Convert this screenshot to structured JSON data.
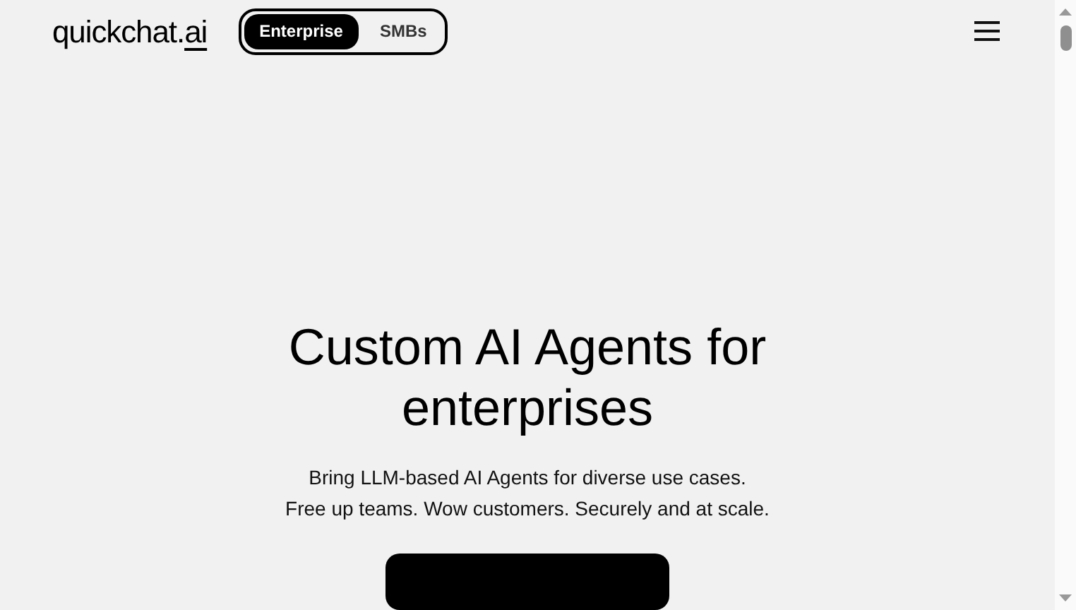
{
  "header": {
    "logo": {
      "name": "quickchat.",
      "suffix": "ai"
    },
    "segments": [
      {
        "label": "Enterprise",
        "selected": true
      },
      {
        "label": "SMBs",
        "selected": false
      }
    ]
  },
  "hero": {
    "title_lines": [
      "Custom AI Agents for",
      "enterprises"
    ],
    "subtitle_lines": [
      "Bring LLM-based AI Agents for diverse use cases.",
      "Free up teams. Wow customers. Securely and at scale."
    ]
  }
}
